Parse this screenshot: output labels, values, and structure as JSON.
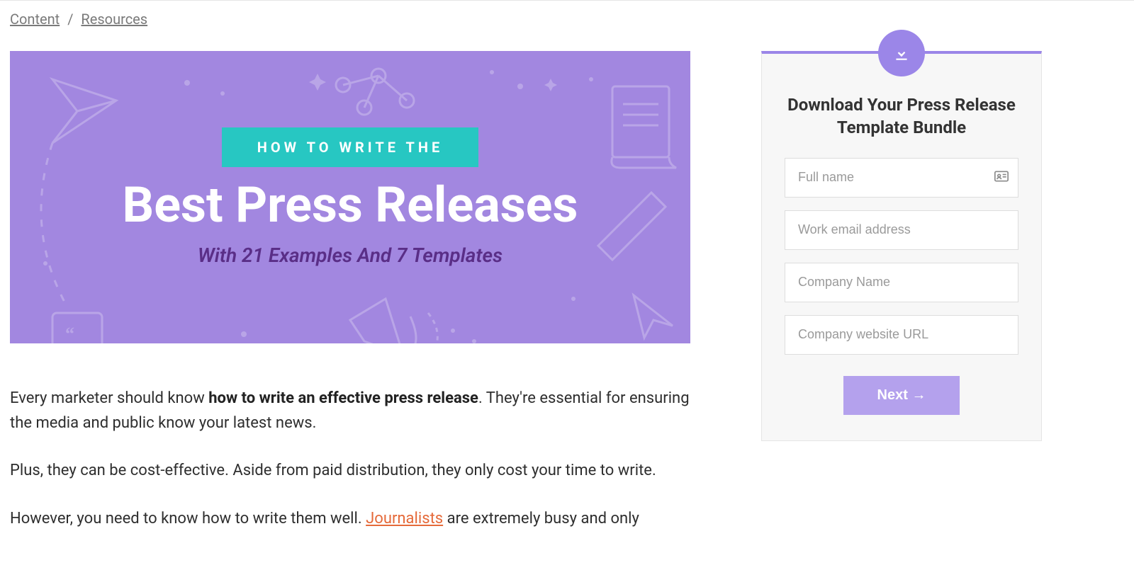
{
  "breadcrumb": {
    "items": [
      "Content",
      "Resources"
    ],
    "separator": "/"
  },
  "hero": {
    "ribbon": "HOW TO WRITE THE",
    "title": "Best Press Releases",
    "subtitle": "With 21 Examples And 7 Templates"
  },
  "article": {
    "p1_pre": "Every marketer should know ",
    "p1_strong": "how to write an effective press release",
    "p1_post": ". They're essential for ensuring the media and public know your latest news.",
    "p2": "Plus, they can be cost-effective. Aside from paid distribution, they only cost your time to write.",
    "p3_pre": "However, you need to know how to write them well. ",
    "p3_link": "Journalists",
    "p3_post": " are extremely busy and only"
  },
  "form": {
    "heading": "Download Your Press Release Template Bundle",
    "fields": {
      "fullname_placeholder": "Full name",
      "email_placeholder": "Work email address",
      "company_placeholder": "Company Name",
      "website_placeholder": "Company website URL"
    },
    "button": "Next →"
  }
}
